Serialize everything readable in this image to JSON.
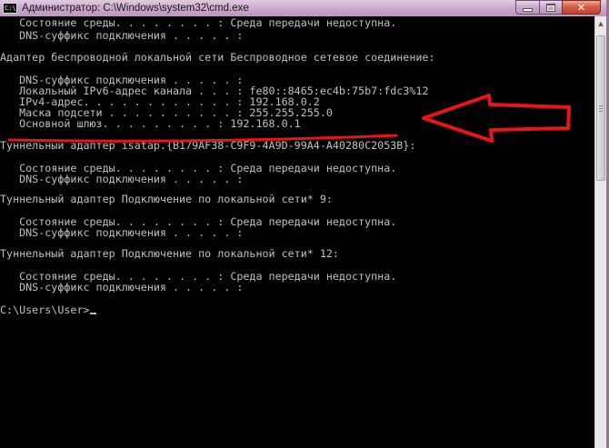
{
  "window": {
    "title": "Администратор: C:\\Windows\\system32\\cmd.exe",
    "icon_text": "C:\\",
    "close_glyph": "✕"
  },
  "console": {
    "lines": [
      "   Состояние среды. . . . . . . . : Среда передачи недоступна.",
      "   DNS-суффикс подключения . . . . . :",
      "",
      "Адаптер беспроводной локальной сети Беспроводное сетевое соединение:",
      "",
      "   DNS-суффикс подключения . . . . . :",
      "   Локальный IPv6-адрес канала . . . : fe80::8465:ec4b:75b7:fdc3%12",
      "   IPv4-адрес. . . . . . . . . . . . : 192.168.0.2",
      "   Маска подсети . . . . . . . . . . : 255.255.255.0",
      "   Основной шлюз. . . . . . . . . : 192.168.0.1",
      "Туннельный адаптер isatap.{B179AF38-C9F9-4A9D-99A4-A40280C2053B}:",
      "",
      "   Состояние среды. . . . . . . . : Среда передачи недоступна.",
      "   DNS-суффикс подключения . . . . . :",
      "",
      "Туннельный адаптер Подключение по локальной сети* 9:",
      "",
      "   Состояние среды. . . . . . . . : Среда передачи недоступна.",
      "   DNS-суффикс подключения . . . . . :",
      "",
      "Туннельный адаптер Подключение по локальной сети* 12:",
      "",
      "   Состояние среды. . . . . . . . : Среда передачи недоступна.",
      "   DNS-суффикс подключения . . . . . :",
      "",
      "C:\\Users\\User>"
    ]
  },
  "colors": {
    "console_bg": "#000000",
    "console_fg": "#c0c0c0",
    "annotation": "#e8141c"
  }
}
